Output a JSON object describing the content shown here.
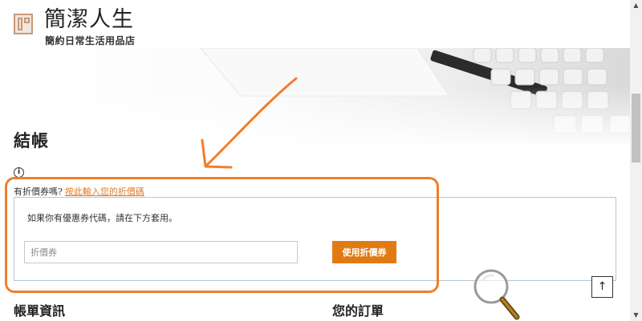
{
  "site": {
    "title": "簡潔人生",
    "tagline": "簡約日常生活用品店"
  },
  "page": {
    "heading": "結帳",
    "info_icon": "info-icon"
  },
  "coupon": {
    "prompt": "有折價券嗎?",
    "link_label": "按此輸入您的折價碼",
    "description": "如果你有優惠券代碼，請在下方套用。",
    "input_placeholder": "折價券",
    "input_value": "",
    "apply_label": "使用折價券"
  },
  "sections": {
    "billing": "帳單資訊",
    "order": "您的訂單"
  },
  "controls": {
    "back_to_top_icon": "arrow-up-icon",
    "back_to_top_glyph": "↑",
    "scroll_up_glyph": "▲",
    "scroll_down_glyph": "▼"
  },
  "annotation": {
    "color": "#f07e2a",
    "magnifier_icon": "magnifier-icon"
  },
  "colors": {
    "accent": "#e07b14",
    "link": "#e07b26",
    "panel_border": "#b5c7d6"
  }
}
